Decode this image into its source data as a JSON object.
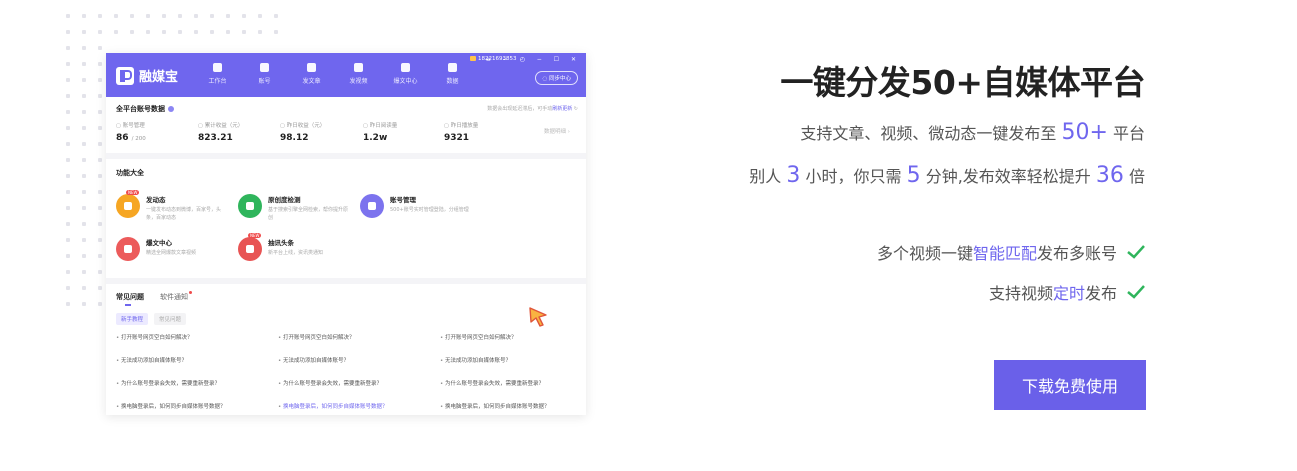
{
  "app": {
    "logo_text": "融媒宝",
    "nav": [
      "工作台",
      "账号",
      "发文章",
      "发视频",
      "爆文中心",
      "数据"
    ],
    "phone": "18221693853",
    "window_controls": "≡ − ◴ − ☐ ✕",
    "sync_button": "◌ 同步中心",
    "stats_title": "全平台账号数据",
    "stats_note_prefix": "数据会出现延迟滞后，可手动",
    "stats_note_link": "刷新更新",
    "stats": [
      {
        "label": "账号管理",
        "value": "86",
        "sub": "/ 200"
      },
      {
        "label": "累计收益（元）",
        "value": "823.21",
        "sub": ""
      },
      {
        "label": "昨日收益（元）",
        "value": "98.12",
        "sub": ""
      },
      {
        "label": "昨日阅读量",
        "value": "1.2w",
        "sub": ""
      },
      {
        "label": "昨日播放量",
        "value": "9321",
        "sub": ""
      }
    ],
    "stats_more": "数据明细 ›",
    "features_title": "功能大全",
    "features": [
      {
        "name": "发动态",
        "desc": "一键发布动态到微博，百家号，头条，百家动态",
        "color": "#f6a623",
        "new": "NEW"
      },
      {
        "name": "原创度检测",
        "desc": "基于搜索引擎全网检索，帮你提升原创",
        "color": "#2fb55c",
        "new": ""
      },
      {
        "name": "账号管理",
        "desc": "500+账号实时管理登陆，分组管理",
        "color": "#7c73ee",
        "new": ""
      },
      {
        "name": "爆文中心",
        "desc": "精选全网爆款文章视频",
        "color": "#ec5b5b",
        "new": ""
      },
      {
        "name": "抽讯头条",
        "desc": "新平台上线，资讯类通知",
        "color": "#e85454",
        "new": "NEW"
      }
    ],
    "faq_tabs": [
      "常见问题",
      "软件通知"
    ],
    "faq_pills": [
      "新手教程",
      "常见问题"
    ],
    "faq_items": [
      "打开账号网页空白如何解决？",
      "打开账号网页空白如何解决？",
      "打开账号网页空白如何解决？",
      "无法成功添加自媒体账号？",
      "无法成功添加自媒体账号？",
      "无法成功添加自媒体账号？",
      "为什么账号登录会失效，需要重新登录？",
      "为什么账号登录会失效，需要重新登录？",
      "为什么账号登录会失效，需要重新登录？",
      "换电脑登录后，如何同步自媒体账号数据？",
      "换电脑登录后，如何同步自媒体账号数据？",
      "换电脑登录后，如何同步自媒体账号数据？"
    ]
  },
  "hero": {
    "headline": "一键分发50+自媒体平台",
    "line1": {
      "prefix": "支持文章、视频、微动态一键发布至",
      "num": "50+",
      "suffix": "平台"
    },
    "line2": {
      "p1": "别人",
      "n1": "3",
      "p2": "小时，你只需",
      "n2": "5",
      "p3": "分钟,发布效率轻松提升",
      "n3": "36",
      "p4": "倍"
    },
    "feature1": {
      "prefix": "多个视频一键",
      "accent": "智能匹配",
      "suffix": "发布多账号"
    },
    "feature2": {
      "prefix": "支持视频",
      "accent": "定时",
      "suffix": "发布"
    },
    "cta": "下载免费使用"
  },
  "colors": {
    "accent": "#6f66ee",
    "check": "#2fb55c"
  },
  "icons": [
    "check-icon",
    "cursor-icon"
  ]
}
